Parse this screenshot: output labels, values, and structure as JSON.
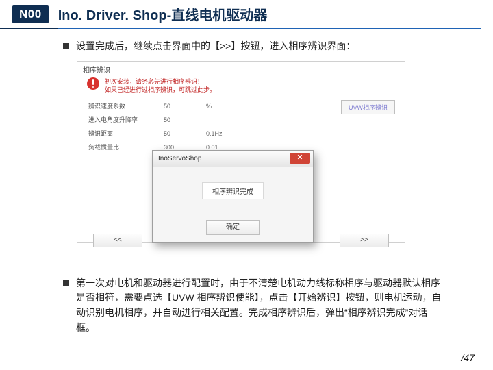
{
  "header": {
    "badge": "N00",
    "title": "Ino. Driver. Shop-直线电机驱动器"
  },
  "bullets": {
    "top": "设置完成后，继续点击界面中的【>>】按钮，进入相序辨识界面：",
    "bottom": "第一次对电机和驱动器进行配置时，由于不清楚电机动力线标称相序与驱动器默认相序是否相符，需要点选【UVW 相序辨识使能】，点击【开始辨识】按钮，则电机运动，自动识别电机相序，并自动进行相关配置。完成相序辨识后，弹出“相序辨识完成”对话框。"
  },
  "panel": {
    "group_label": "相序辨识",
    "warning_line1": "初次安装，请务必先进行相序辨识！",
    "warning_line2": "如果已经进行过相序辨识，可跳过此步。",
    "rows": [
      {
        "label": "辨识速度系数",
        "value": "50",
        "unit": "%"
      },
      {
        "label": "进入电角度升降率",
        "value": "50",
        "unit": ""
      },
      {
        "label": "辨识距离",
        "value": "50",
        "unit": "0.1Hz"
      },
      {
        "label": "负载惯量比",
        "value": "300",
        "unit": "0.01"
      }
    ],
    "uvw_button": "UVW相序辨识",
    "nav_prev": "<<",
    "nav_next": ">>"
  },
  "modal": {
    "title": "InoServoShop",
    "message": "相序辨识完成",
    "ok": "确定"
  },
  "page_number": "/47"
}
